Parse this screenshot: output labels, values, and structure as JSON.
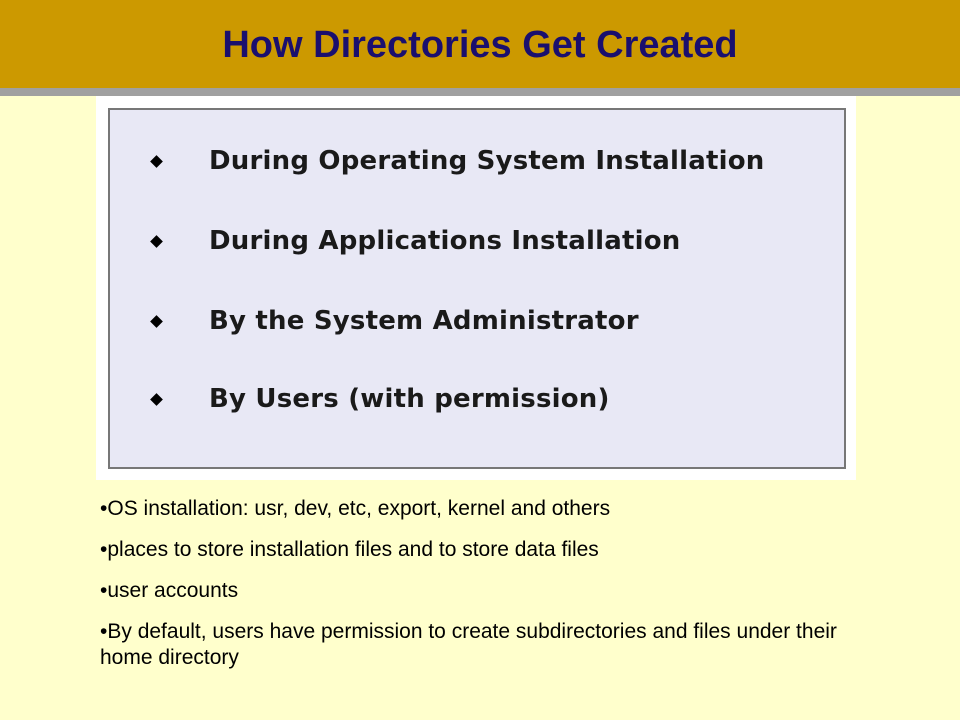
{
  "title": "How Directories Get Created",
  "box_items": [
    "During Operating System Installation",
    "During Applications Installation",
    "By the System Administrator",
    "By Users (with permission)"
  ],
  "bullet_char": "•",
  "notes": [
    "OS installation: usr, dev, etc, export, kernel and others",
    "places to store installation files and to store data files",
    "user accounts",
    "By default, users have permission to create subdirectories and files under their home directory"
  ],
  "colors": {
    "title_bar": "#cc9900",
    "title_text": "#1a0f6e",
    "background": "#ffffcc",
    "box_fill": "#e8e8f5"
  },
  "icons": {
    "box_bullet": "diamond-bullet-icon"
  }
}
